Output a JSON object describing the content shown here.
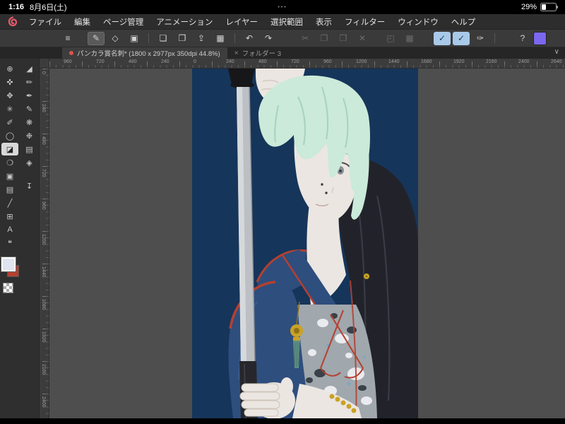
{
  "status_bar": {
    "time": "1:16",
    "date": "8月6日(土)",
    "multitask_dots": "•••",
    "battery_percent": "29%"
  },
  "menu_bar": {
    "logo": "clip-studio-paint-logo",
    "items": [
      {
        "id": "file",
        "label": "ファイル"
      },
      {
        "id": "edit",
        "label": "編集"
      },
      {
        "id": "page-management",
        "label": "ページ管理"
      },
      {
        "id": "animation",
        "label": "アニメーション"
      },
      {
        "id": "layer",
        "label": "レイヤー"
      },
      {
        "id": "selection",
        "label": "選択範囲"
      },
      {
        "id": "view",
        "label": "表示"
      },
      {
        "id": "filter",
        "label": "フィルター"
      },
      {
        "id": "window",
        "label": "ウィンドウ"
      },
      {
        "id": "help",
        "label": "ヘルプ"
      }
    ]
  },
  "command_bar": {
    "items": [
      {
        "name": "main-menu",
        "glyph": "≡"
      },
      {
        "gap": 10
      },
      {
        "name": "brush-tool-shortcut",
        "glyph": "✎",
        "state": "selected"
      },
      {
        "name": "tool-property",
        "glyph": "◇"
      },
      {
        "name": "reference",
        "glyph": "▣"
      },
      {
        "sep": true
      },
      {
        "name": "canvas-settings",
        "glyph": "❏"
      },
      {
        "name": "open-file",
        "glyph": "❐"
      },
      {
        "name": "share",
        "glyph": "⇪"
      },
      {
        "name": "gallery",
        "glyph": "▦"
      },
      {
        "sep": true
      },
      {
        "name": "undo",
        "glyph": "↶"
      },
      {
        "name": "redo",
        "glyph": "↷"
      },
      {
        "gap": 22
      },
      {
        "name": "cut",
        "glyph": "✂",
        "state": "disabled"
      },
      {
        "name": "copy",
        "glyph": "❐",
        "state": "disabled"
      },
      {
        "name": "paste",
        "glyph": "❒",
        "state": "disabled"
      },
      {
        "name": "delete",
        "glyph": "✕",
        "state": "disabled"
      },
      {
        "gap": 10
      },
      {
        "name": "transform",
        "glyph": "◰",
        "state": "disabled"
      },
      {
        "name": "mesh-transform",
        "glyph": "▦",
        "state": "disabled"
      },
      {
        "spacer": true
      },
      {
        "name": "snap-to-ruler",
        "glyph": "✓",
        "state": "active"
      },
      {
        "name": "snap-to-special-ruler",
        "glyph": "✓",
        "state": "active"
      },
      {
        "name": "stroke-correction",
        "glyph": "✑"
      },
      {
        "sep": true
      },
      {
        "spacer": true
      },
      {
        "name": "help",
        "glyph": "?"
      },
      {
        "name": "sub-view-color",
        "swatch": "#7b68ee"
      }
    ]
  },
  "tab_bar": {
    "tabs": [
      {
        "id": "document",
        "title": "パンカラ賞名刺* (1800 x 2977px 350dpi 44.8%)",
        "active": true,
        "modified": true
      },
      {
        "id": "folder-3",
        "title": "フォルダー 3",
        "active": false,
        "modified": false
      }
    ],
    "collapse_glyph": "∨"
  },
  "tool_panel": {
    "column1": [
      {
        "name": "zoom-tool",
        "glyph": "⊕"
      },
      {
        "name": "hand-tool",
        "glyph": "✜"
      },
      {
        "name": "move-tool",
        "glyph": "✥"
      },
      {
        "name": "rotate-view-tool",
        "glyph": "✳"
      },
      {
        "name": "operation-tool",
        "glyph": "✐"
      },
      {
        "name": "lasso-tool",
        "glyph": "◯"
      },
      {
        "name": "eraser-tool",
        "glyph": "◪",
        "selected": true
      },
      {
        "name": "blend-tool",
        "glyph": "❍"
      },
      {
        "name": "fill-tool",
        "glyph": "▣"
      },
      {
        "name": "gradient-tool",
        "glyph": "▤"
      },
      {
        "name": "figure-tool",
        "glyph": "╱"
      },
      {
        "name": "frame-border-tool",
        "glyph": "⊞"
      },
      {
        "name": "text-tool",
        "glyph": "A"
      },
      {
        "name": "balloon-tool",
        "glyph": "❝"
      }
    ],
    "column2": [
      {
        "name": "kneaded-eraser-tool",
        "glyph": "◢"
      },
      {
        "name": "pencil-tool",
        "glyph": "✏"
      },
      {
        "name": "pen-tool",
        "glyph": "✒"
      },
      {
        "name": "brush-tool",
        "glyph": "✎"
      },
      {
        "name": "airbrush-tool",
        "glyph": "❋"
      },
      {
        "name": "decoration-tool",
        "glyph": "❉"
      },
      {
        "name": "layer-panel-toggle",
        "glyph": "▤"
      },
      {
        "name": "material-panel-toggle",
        "glyph": "◈"
      }
    ],
    "tray_glyph": "↧",
    "swatches": {
      "main": "#dfe4ee",
      "sub": "#b5402f"
    }
  },
  "rulers": {
    "top": [
      "960",
      "720",
      "480",
      "240",
      "0",
      "240",
      "480",
      "720",
      "960",
      "1200",
      "1440",
      "1680",
      "1920",
      "2160",
      "2400",
      "2640"
    ],
    "left": [
      "0",
      "240",
      "480",
      "720",
      "960",
      "1200",
      "1440",
      "1680",
      "1920",
      "2160",
      "2400"
    ]
  },
  "canvas": {
    "document_info": "1800 x 2977px 350dpi",
    "zoom": "44.8%",
    "palette": {
      "bg": "#16355a",
      "skin": "#ebe6e1",
      "skin_shadow": "#d5cbc2",
      "hair": "#cbead9",
      "hair_shadow": "#a6d2bf",
      "coat": "#22232a",
      "coat_fold": "#3a3d47",
      "kimono": "#2e4e7e",
      "kimono_light": "#3c5c8e",
      "trim_red": "#b5402f",
      "fabric": "#a0a7ad",
      "fabric_light": "#e9ebee",
      "fabric_dark": "#3a4148",
      "accent_teal": "#7fa8bd",
      "gold": "#c9a227",
      "gold_dark": "#8f7118",
      "tassel": "#5d8f85",
      "tassel_dark": "#49756c",
      "blade": "#bcc0c4",
      "blade_light": "#d6d9dc",
      "blade_dark": "#8e9296",
      "handle": "#17171a",
      "scabbard": "#26262b",
      "eye_iris": "#8a9096",
      "eye_dark": "#3b4046",
      "line_dark": "#4a4a4a",
      "mole": "#3d3d3d",
      "mouth": "#c2a79e"
    }
  },
  "ui_colors": {
    "selected_tool_bg": "#d8d8d8",
    "active_toggle_bg": "#a9c9e9",
    "tab_modified_dot": "#e0524d",
    "command_swatch_purple": "#7b68ee"
  }
}
